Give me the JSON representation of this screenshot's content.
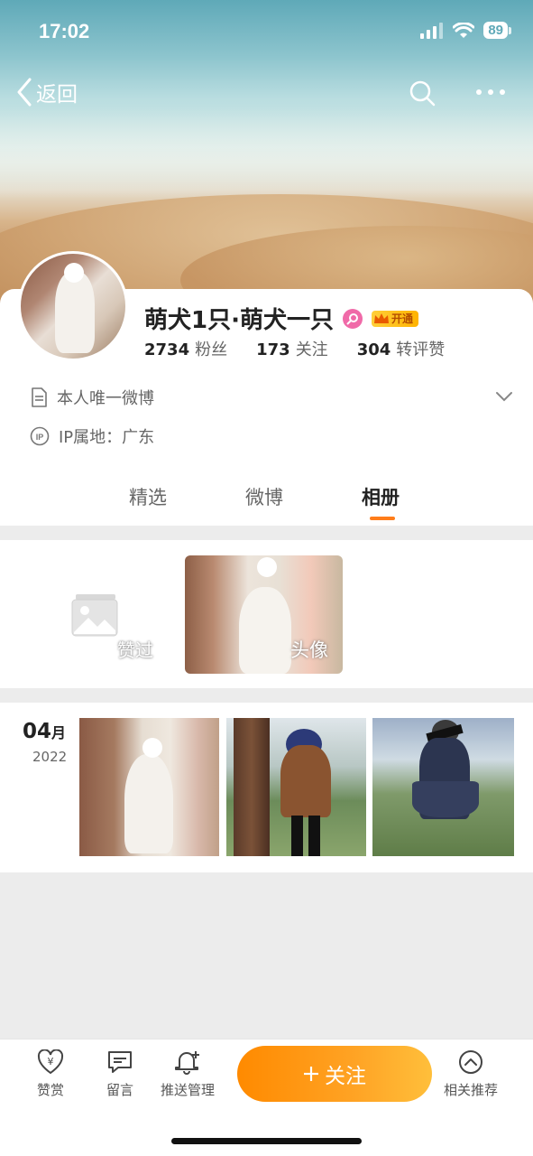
{
  "status_bar": {
    "time": "17:02",
    "battery": "89"
  },
  "nav": {
    "back_label": "返回"
  },
  "profile": {
    "name": "萌犬1只·萌犬一只",
    "vip_label": "开通",
    "stats": [
      {
        "value": "2734",
        "label": "粉丝"
      },
      {
        "value": "173",
        "label": "关注"
      },
      {
        "value": "304",
        "label": "转评赞"
      }
    ],
    "bio": "本人唯一微博",
    "ip_location": "IP属地：广东"
  },
  "tabs": [
    "精选",
    "微博",
    "相册"
  ],
  "albums": {
    "liked_label": "赞过",
    "avatar_label": "头像"
  },
  "timeline": {
    "month": "04",
    "month_unit": "月",
    "year": "2022"
  },
  "bottom_bar": {
    "reward": "赞赏",
    "message": "留言",
    "push": "推送管理",
    "follow": "关注",
    "related": "相关推荐"
  },
  "colors": {
    "accent": "#ff7d1a",
    "follow_gradient_start": "#ff8a00",
    "follow_gradient_end": "#ffbf3b",
    "vip": "#ffb300",
    "gender": "#f06aa8"
  },
  "icons": [
    "chevron-left-icon",
    "search-icon",
    "more-icon",
    "document-icon",
    "ip-icon",
    "chevron-down-icon",
    "image-placeholder-icon",
    "reward-icon",
    "message-icon",
    "bell-plus-icon",
    "plus-icon",
    "chevron-up-circle-icon"
  ]
}
